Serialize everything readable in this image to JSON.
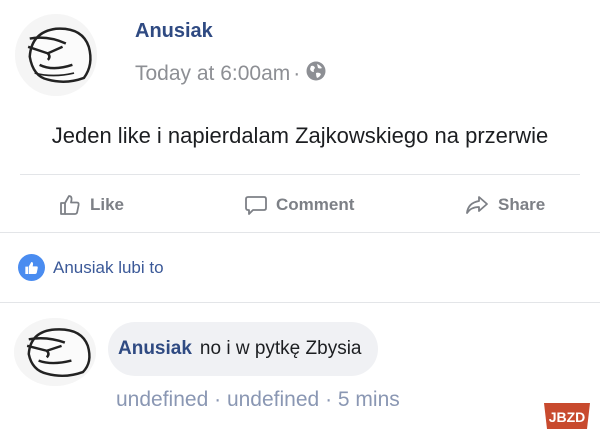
{
  "post": {
    "author": "Anusiak",
    "time": "Today at 6:00am",
    "time_separator": "·",
    "privacy_icon": "globe-icon",
    "text": "Jeden like i napierdalam Zajkowskiego na przerwie"
  },
  "actions": {
    "like_label": "Like",
    "comment_label": "Comment",
    "share_label": "Share"
  },
  "reactions": {
    "summary": "Anusiak lubi to"
  },
  "comment": {
    "author": "Anusiak",
    "text": "no i w pytkę Zbysia",
    "meta_1": "undefined",
    "meta_2": "undefined",
    "meta_3": "5 mins",
    "separator": "·"
  },
  "watermark": {
    "text": "JBZD"
  },
  "colors": {
    "author": "#2f4a82",
    "meta": "#8d8f94",
    "action": "#7d8086",
    "like_badge": "#4a8cf0",
    "bubble": "#f0f1f4",
    "watermark": "#c84a2e"
  }
}
